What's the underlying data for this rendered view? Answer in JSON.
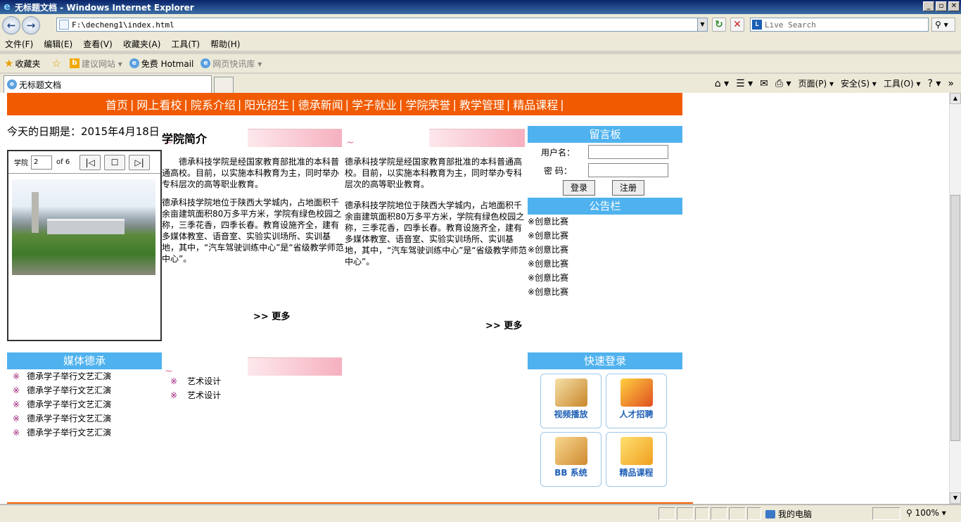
{
  "window": {
    "title": "无标题文档 - Windows Internet Explorer",
    "controls": [
      "_",
      "▫",
      "✕"
    ]
  },
  "address": {
    "url": "F:\\decheng1\\index.html",
    "search_placeholder": "Live Search"
  },
  "menu": [
    "文件(F)",
    "编辑(E)",
    "查看(V)",
    "收藏夹(A)",
    "工具(T)",
    "帮助(H)"
  ],
  "favorites": {
    "label": "收藏夹",
    "suggested": "建议网站 ▾",
    "hotmail": "免费 Hotmail",
    "webslice": "网页快讯库 ▾"
  },
  "tab": {
    "title": "无标题文档"
  },
  "commands": {
    "page": "页面(P) ▾",
    "safety": "安全(S) ▾",
    "tools": "工具(O) ▾"
  },
  "site": {
    "nav": [
      "首页",
      "网上看校",
      "院系介绍",
      "阳光招生",
      "德承新闻",
      "学子就业",
      "学院荣誉",
      "教学管理",
      "精品课程"
    ],
    "date_text": "今天的日期是：2015年4月18日",
    "pdf": {
      "label": "学院",
      "page": "2",
      "of": "of 6"
    },
    "intro": {
      "title": "学院简介",
      "p1": "德承科技学院是经国家教育部批准的本科普通高校。目前，以实施本科教育为主，同时举办专科层次的高等职业教育。",
      "p2": "德承科技学院地位于陕西大学城内，占地面积千余亩建筑面积80万多平方米，学院有绿色校园之称，三季花香，四季长春。教育设施齐全，建有多媒体教室、语音室、实验实训场所、实训基地，其中，“汽车驾驶训练中心”是“省级教学师范中心”。",
      "more": ">> 更多"
    },
    "intro2": {
      "p1": "德承科技学院是经国家教育部批准的本科普通高校。目前，以实施本科教育为主，同时举办专科层次的高等职业教育。",
      "p2": "德承科技学院地位于陕西大学城内，占地面积千余亩建筑面积80万多平方米，学院有绿色校园之称，三季花香，四季长春。教育设施齐全，建有多媒体教室、语音室、实验实训场所、实训基地，其中，“汽车驾驶训练中心”是“省级教学师范中心”。",
      "more": ">> 更多"
    },
    "guestbook": {
      "title": "留言板",
      "username_label": "用户名：",
      "password_label": "密  码：",
      "login": "登录",
      "register": "注册"
    },
    "notice": {
      "title": "公告栏",
      "items": [
        "※创意比赛",
        "※创意比赛",
        "※创意比赛",
        "※创意比赛",
        "※创意比赛",
        "※创意比赛"
      ]
    },
    "media": {
      "title": "媒体德承",
      "items": [
        "德承学子举行文艺汇演",
        "德承学子举行文艺汇演",
        "德承学子举行文艺汇演",
        "德承学子举行文艺汇演",
        "德承学子举行文艺汇演"
      ]
    },
    "art": {
      "items": [
        "艺术设计",
        "艺术设计"
      ]
    },
    "quick": {
      "title": "快速登录",
      "tiles": [
        "视频播放",
        "人才招聘",
        "BB 系统",
        "精品课程"
      ]
    }
  },
  "status": {
    "zone": "我的电脑",
    "zoom": "100%"
  },
  "colors": {
    "nav": "#f05a00",
    "panel_head": "#4fb2ee",
    "mark": "#9b1f7a"
  }
}
